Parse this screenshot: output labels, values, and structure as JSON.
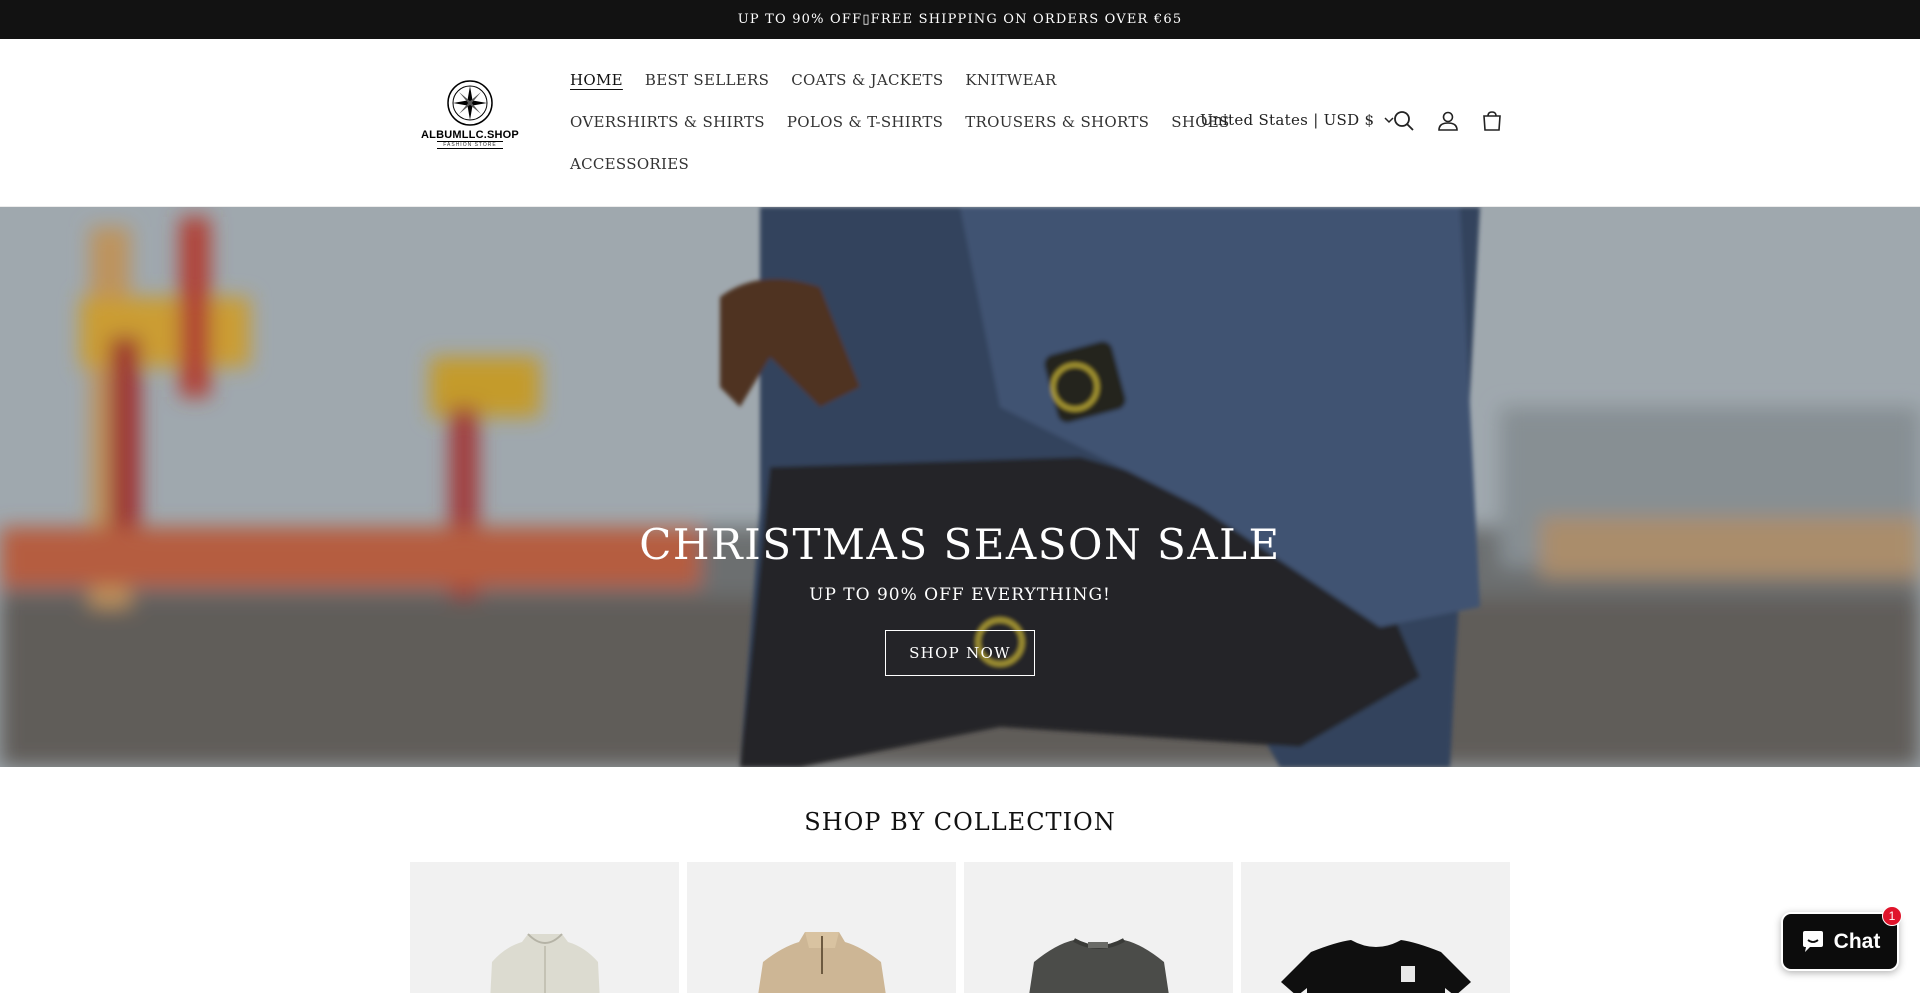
{
  "announcement": {
    "text": "UP TO 90% OFF▯FREE SHIPPING ON ORDERS OVER €65"
  },
  "header": {
    "logo_text": "ALBUMLLC.SHOP",
    "logo_sub": "FASHION STORE",
    "nav_rows": [
      [
        "HOME",
        "BEST SELLERS",
        "COATS & JACKETS",
        "KNITWEAR"
      ],
      [
        "OVERSHIRTS & SHIRTS",
        "POLOS & T-SHIRTS",
        "TROUSERS & SHORTS",
        "SHOES"
      ],
      [
        "ACCESSORIES"
      ]
    ],
    "active_nav": "HOME",
    "locale": "United States | USD $",
    "icons": [
      "search-icon",
      "account-icon",
      "cart-icon"
    ]
  },
  "hero": {
    "title": "CHRISTMAS SEASON SALE",
    "subtitle": "UP TO 90% OFF EVERYTHING!",
    "button": "SHOP NOW"
  },
  "collections": {
    "title": "SHOP BY COLLECTION",
    "items": [
      "vest-product",
      "quarter-zip-product",
      "sweater-product",
      "tshirt-product"
    ]
  },
  "chat": {
    "label": "Chat",
    "badge": "1"
  },
  "colors": {
    "announce_bg": "#121212",
    "chat_badge": "#e0142b"
  }
}
